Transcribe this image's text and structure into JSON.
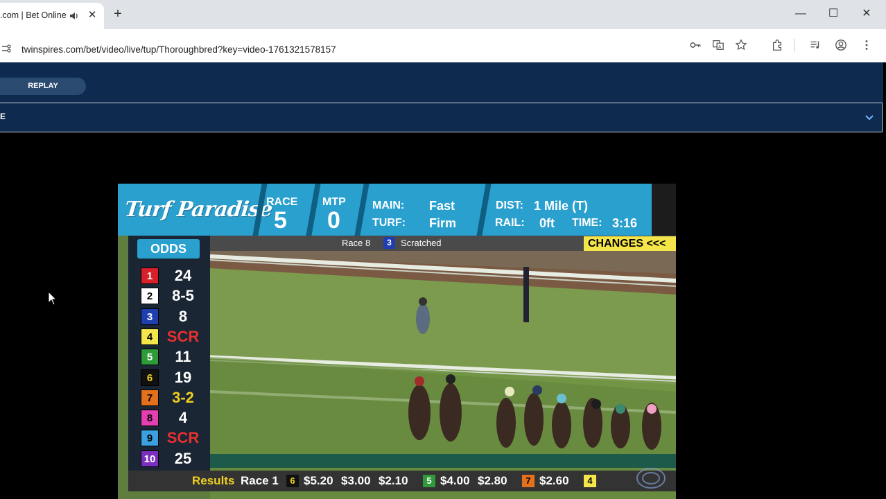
{
  "browser": {
    "tab_title": ".com | Bet Online",
    "new_tab_symbol": "+",
    "tab_close_symbol": "✕",
    "url": "twinspires.com/bet/video/live/tup/Thoroughbred?key=video-1761321578157",
    "window_controls": {
      "minimize": "—",
      "maximize": "☐",
      "close": "✕"
    }
  },
  "site": {
    "replay_label": "REPLAY",
    "race_selector_label": "E"
  },
  "video": {
    "track_name": "Turf Paradise",
    "race_label": "RACE",
    "race_number": "5",
    "mtp_label": "MTP",
    "mtp_value": "0",
    "main_label": "MAIN:",
    "main_value": "Fast",
    "turf_label": "TURF:",
    "turf_value": "Firm",
    "dist_label": "DIST:",
    "dist_value": "1 Mile (T)",
    "rail_label": "RAIL:",
    "rail_value": "0ft",
    "time_label": "TIME:",
    "time_value": "3:16",
    "odds_header": "ODDS",
    "odds": [
      {
        "pp": "1",
        "value": "24",
        "bg": "#d8202a",
        "fg": "#ffffff"
      },
      {
        "pp": "2",
        "value": "8-5",
        "bg": "#ffffff",
        "fg": "#000000"
      },
      {
        "pp": "3",
        "value": "8",
        "bg": "#1f3fb0",
        "fg": "#ffffff"
      },
      {
        "pp": "4",
        "value": "SCR",
        "bg": "#f4e64a",
        "fg": "#000000"
      },
      {
        "pp": "5",
        "value": "11",
        "bg": "#2f9a3a",
        "fg": "#ffffff"
      },
      {
        "pp": "6",
        "value": "19",
        "bg": "#111111",
        "fg": "#f0d020"
      },
      {
        "pp": "7",
        "value": "3-2",
        "bg": "#e2701c",
        "fg": "#000000"
      },
      {
        "pp": "8",
        "value": "4",
        "bg": "#e43fb0",
        "fg": "#000000"
      },
      {
        "pp": "9",
        "value": "SCR",
        "bg": "#3aa0e0",
        "fg": "#000000"
      },
      {
        "pp": "10",
        "value": "25",
        "bg": "#7b2fc0",
        "fg": "#ffffff"
      }
    ],
    "strip": {
      "race": "Race 8",
      "scratch_pp": "3",
      "scratch_text": "Scratched"
    },
    "changes_label": "CHANGES <<<",
    "results": {
      "label": "Results",
      "race": "Race 1",
      "entries": [
        {
          "pp": "6",
          "bg": "#111111",
          "fg": "#f0d020",
          "amounts": [
            "$5.20",
            "$3.00",
            "$2.10"
          ]
        },
        {
          "pp": "5",
          "bg": "#2f9a3a",
          "fg": "#ffffff",
          "amounts": [
            "$4.00",
            "$2.80"
          ]
        },
        {
          "pp": "7",
          "bg": "#e2701c",
          "fg": "#000000",
          "amounts": [
            "$2.60"
          ]
        },
        {
          "pp": "4",
          "bg": "#f4e64a",
          "fg": "#000000",
          "amounts": []
        }
      ]
    }
  }
}
